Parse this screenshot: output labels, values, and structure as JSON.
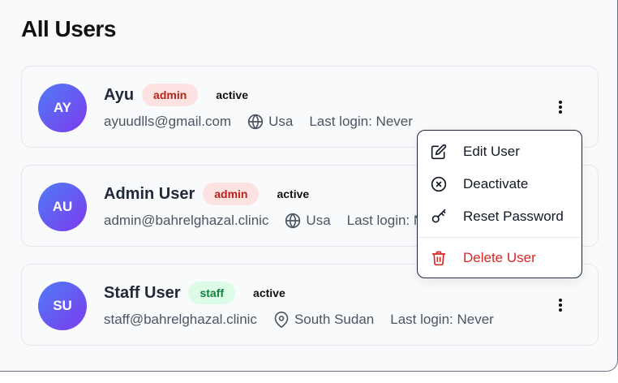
{
  "page": {
    "title": "All Users"
  },
  "users": [
    {
      "initials": "AY",
      "name": "Ayu",
      "role": "admin",
      "status": "active",
      "email": "ayuudlls@gmail.com",
      "location": "Usa",
      "location_icon": "globe-icon",
      "last_login": "Last login: Never"
    },
    {
      "initials": "AU",
      "name": "Admin User",
      "role": "admin",
      "status": "active",
      "email": "admin@bahrelghazal.clinic",
      "location": "Usa",
      "location_icon": "globe-icon",
      "last_login": "Last login: Never"
    },
    {
      "initials": "SU",
      "name": "Staff User",
      "role": "staff",
      "status": "active",
      "email": "staff@bahrelghazal.clinic",
      "location": "South Sudan",
      "location_icon": "map-pin-icon",
      "last_login": "Last login: Never"
    }
  ],
  "menu": {
    "items": [
      {
        "label": "Edit User",
        "icon": "edit-icon"
      },
      {
        "label": "Deactivate",
        "icon": "x-circle-icon"
      },
      {
        "label": "Reset Password",
        "icon": "key-icon"
      },
      {
        "label": "Delete User",
        "icon": "trash-icon"
      }
    ]
  },
  "colors": {
    "admin_badge_bg": "#fde2e2",
    "admin_badge_text": "#b42318",
    "staff_badge_bg": "#dcfce7",
    "staff_badge_text": "#15803d",
    "danger": "#dc2626",
    "avatar_gradient_start": "#4f7cf7",
    "avatar_gradient_end": "#7c3aed"
  }
}
